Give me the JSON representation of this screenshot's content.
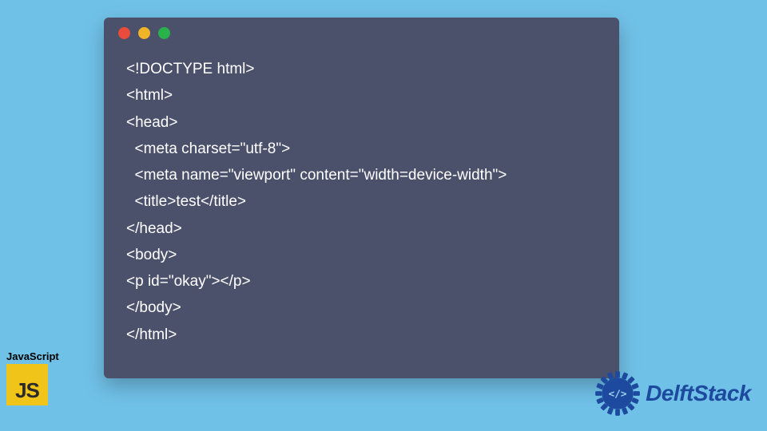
{
  "code_window": {
    "lines": [
      "<!DOCTYPE html>",
      "<html>",
      "<head>",
      "  <meta charset=\"utf-8\">",
      "  <meta name=\"viewport\" content=\"width=device-width\">",
      "  <title>test</title>",
      "</head>",
      "<body>",
      "<p id=\"okay\"></p>",
      "</body>",
      "</html>"
    ]
  },
  "js_badge": {
    "label": "JavaScript",
    "logo_text": "JS"
  },
  "brand": {
    "name": "DelftStack"
  },
  "colors": {
    "background": "#70c1e8",
    "window": "#4b506b",
    "js_yellow": "#f0c419",
    "brand_blue": "#1d4a9e"
  }
}
